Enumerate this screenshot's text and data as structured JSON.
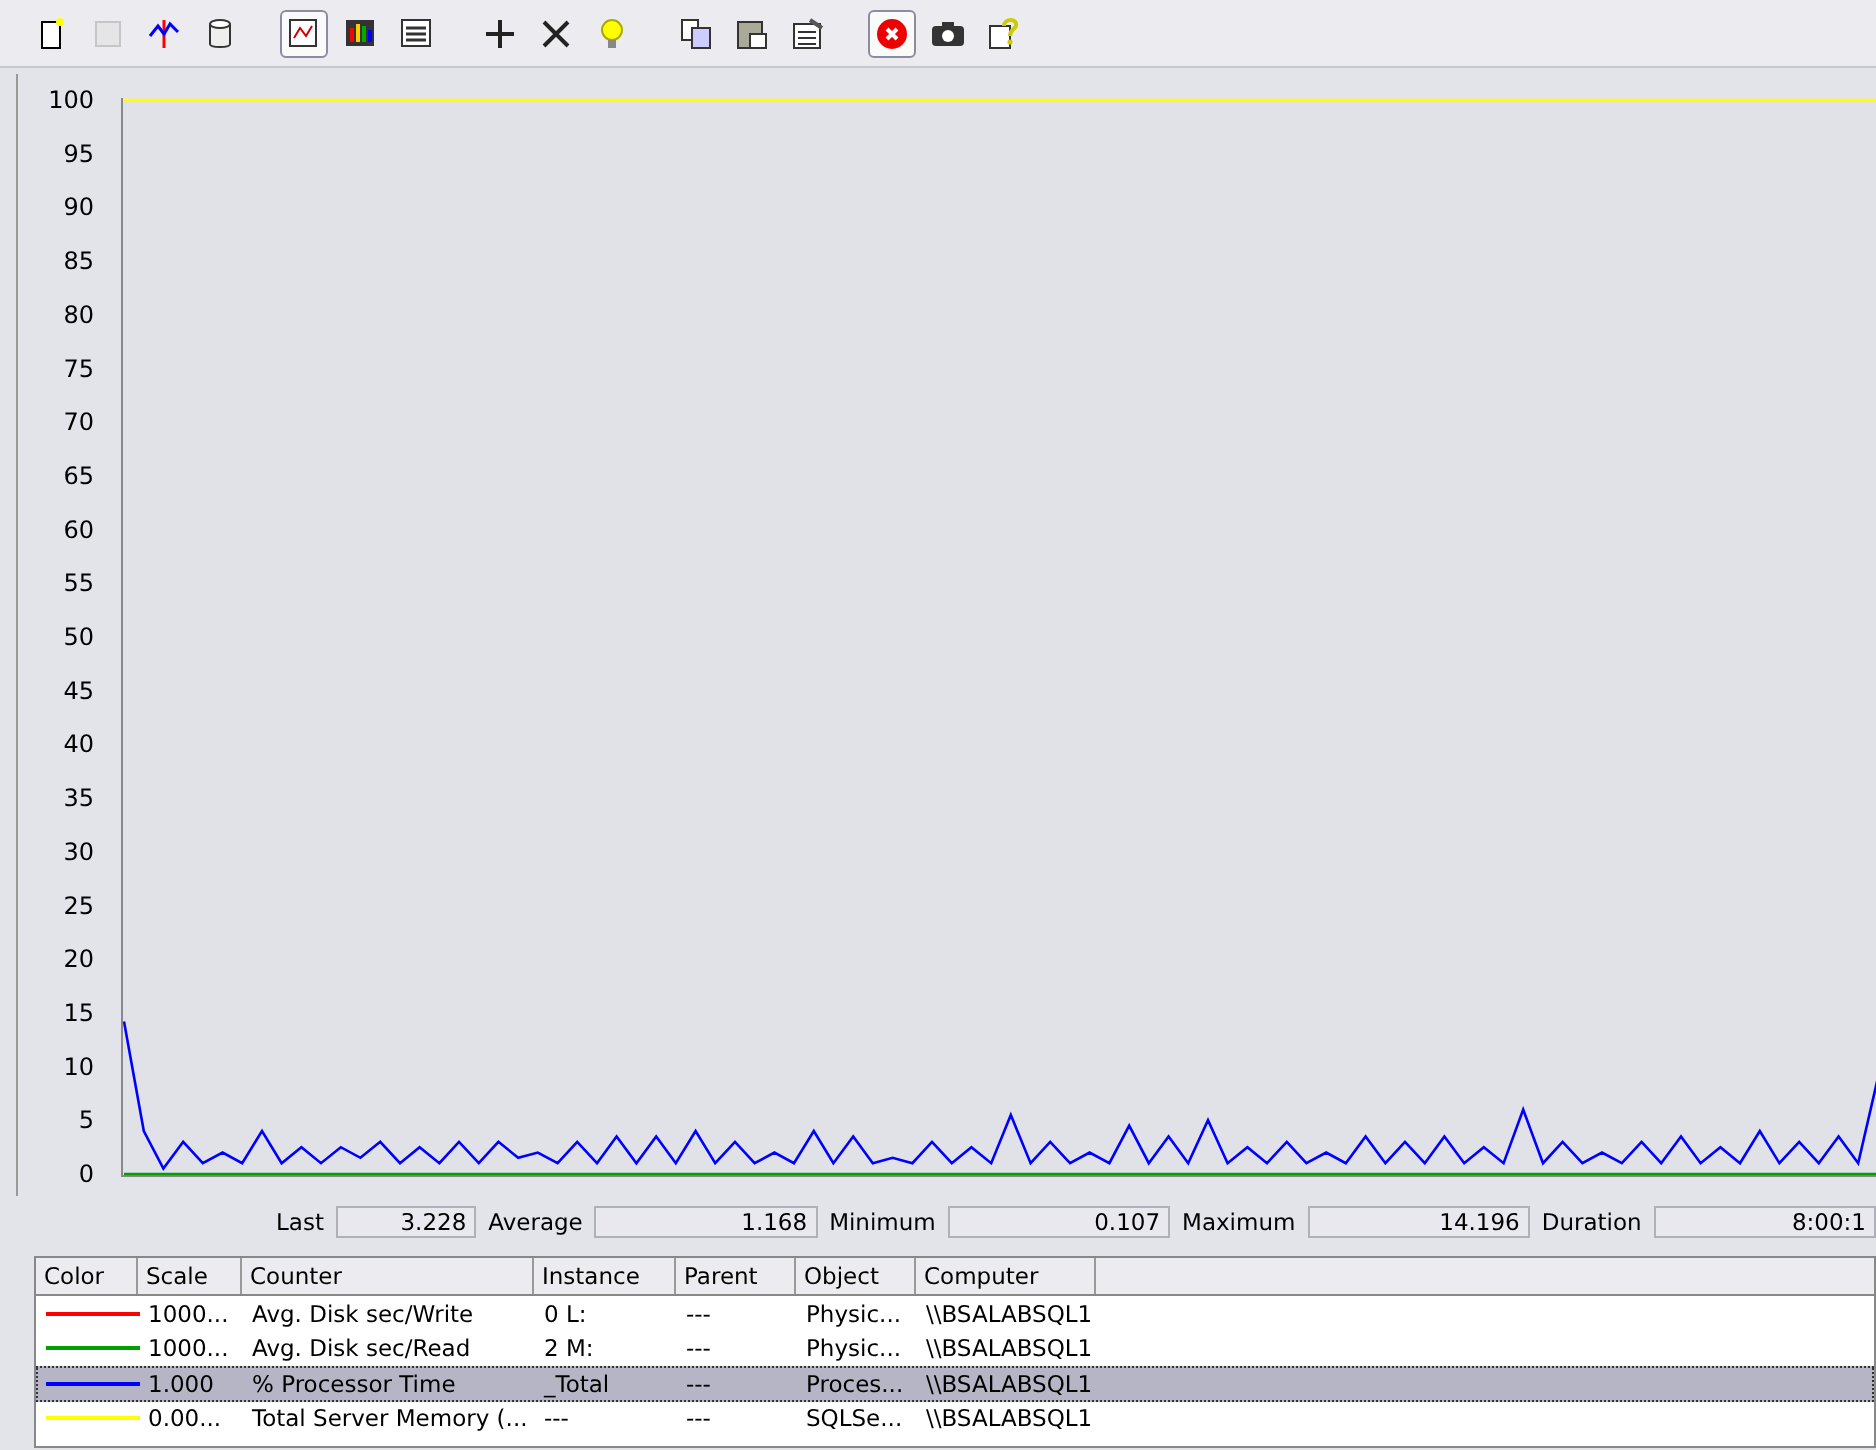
{
  "toolbar": [
    {
      "kind": "new",
      "selected": false,
      "disabled": false
    },
    {
      "kind": "clear",
      "selected": false,
      "disabled": true
    },
    {
      "kind": "spark",
      "selected": false,
      "disabled": false
    },
    {
      "kind": "database",
      "selected": false,
      "disabled": false
    },
    {
      "kind": "graph",
      "selected": true,
      "disabled": false
    },
    {
      "kind": "histogram",
      "selected": false,
      "disabled": false
    },
    {
      "kind": "report",
      "selected": false,
      "disabled": false
    },
    {
      "kind": "add",
      "selected": false,
      "disabled": false
    },
    {
      "kind": "delete",
      "selected": false,
      "disabled": false
    },
    {
      "kind": "bulb",
      "selected": false,
      "disabled": false
    },
    {
      "kind": "copy",
      "selected": false,
      "disabled": false
    },
    {
      "kind": "paste",
      "selected": false,
      "disabled": false
    },
    {
      "kind": "properties",
      "selected": false,
      "disabled": false
    },
    {
      "kind": "stop",
      "selected": true,
      "disabled": false
    },
    {
      "kind": "camera",
      "selected": false,
      "disabled": false
    },
    {
      "kind": "help",
      "selected": false,
      "disabled": false
    }
  ],
  "graph": {
    "chart_data": {
      "type": "line",
      "ylim": [
        0,
        100
      ],
      "yticks": [
        0,
        5,
        10,
        15,
        20,
        25,
        30,
        35,
        40,
        45,
        50,
        55,
        60,
        65,
        70,
        75,
        80,
        85,
        90,
        95,
        100
      ],
      "series": [
        {
          "color": "#00a000",
          "values": [
            0,
            0,
            0,
            0,
            0,
            0,
            0,
            0,
            0,
            0,
            0,
            0,
            0,
            0,
            0,
            0,
            0,
            0,
            0,
            0,
            0,
            0,
            0,
            0,
            0,
            0,
            0,
            0,
            0,
            0,
            0,
            0,
            0,
            0,
            0,
            0,
            0,
            0,
            0,
            0,
            0,
            0,
            0,
            0,
            0,
            0,
            0,
            0,
            0,
            0,
            0,
            0,
            0,
            0,
            0,
            0,
            0,
            0,
            0,
            0,
            0,
            0,
            0,
            0,
            0,
            0,
            0,
            0,
            0,
            0,
            0,
            0,
            0,
            0,
            0,
            0,
            0,
            0,
            0,
            0,
            0,
            0,
            0,
            0,
            0,
            0,
            0,
            0,
            0,
            0
          ]
        },
        {
          "color": "#0000ff",
          "values": [
            14.2,
            4,
            0.5,
            3,
            1,
            2,
            1,
            4,
            1,
            2.5,
            1,
            2.5,
            1.5,
            3,
            1,
            2.5,
            1,
            3,
            1,
            3,
            1.5,
            2,
            1,
            3,
            1,
            3.5,
            1,
            3.5,
            1,
            4,
            1,
            3,
            1,
            2,
            1,
            4,
            1,
            3.5,
            1,
            1.5,
            1,
            3,
            1,
            2.5,
            1,
            5.5,
            1,
            3,
            1,
            2,
            1,
            4.5,
            1,
            3.5,
            1,
            5,
            1,
            2.5,
            1,
            3,
            1,
            2,
            1,
            3.5,
            1,
            3,
            1,
            3.5,
            1,
            2.5,
            1,
            6,
            1,
            3,
            1,
            2,
            1,
            3,
            1,
            3.5,
            1,
            2.5,
            1,
            4,
            1,
            3,
            1,
            3.5,
            1,
            9
          ]
        },
        {
          "color": "#ffff00",
          "values": [
            100,
            100,
            100,
            100,
            100,
            100,
            100,
            100,
            100,
            100,
            100,
            100,
            100,
            100,
            100,
            100,
            100,
            100,
            100,
            100,
            100,
            100,
            100,
            100,
            100,
            100,
            100,
            100,
            100,
            100,
            100,
            100,
            100,
            100,
            100,
            100,
            100,
            100,
            100,
            100,
            100,
            100,
            100,
            100,
            100,
            100,
            100,
            100,
            100,
            100,
            100,
            100,
            100,
            100,
            100,
            100,
            100,
            100,
            100,
            100,
            100,
            100,
            100,
            100,
            100,
            100,
            100,
            100,
            100,
            100,
            100,
            100,
            100,
            100,
            100,
            100,
            100,
            100,
            100,
            100,
            100,
            100,
            100,
            100,
            100,
            100,
            100,
            100,
            100,
            100
          ]
        }
      ]
    }
  },
  "stats": [
    {
      "label": "Last",
      "value": "3.228"
    },
    {
      "label": "Average",
      "value": "1.168"
    },
    {
      "label": "Minimum",
      "value": "0.107"
    },
    {
      "label": "Maximum",
      "value": "14.196"
    },
    {
      "label": "Duration",
      "value": "8:00:1"
    }
  ],
  "legend": {
    "columns": [
      "Color",
      "Scale",
      "Counter",
      "Instance",
      "Parent",
      "Object",
      "Computer"
    ],
    "rows": [
      {
        "color": "#ff0000",
        "scale": "1000...",
        "counter": "Avg. Disk sec/Write",
        "instance": "0 L:",
        "parent": "---",
        "object": "Physic...",
        "computer": "\\\\BSALABSQL1",
        "selected": false
      },
      {
        "color": "#00a000",
        "scale": "1000...",
        "counter": "Avg. Disk sec/Read",
        "instance": "2 M:",
        "parent": "---",
        "object": "Physic...",
        "computer": "\\\\BSALABSQL1",
        "selected": false
      },
      {
        "color": "#0000ff",
        "scale": "1.000",
        "counter": "% Processor Time",
        "instance": "_Total",
        "parent": "---",
        "object": "Proces...",
        "computer": "\\\\BSALABSQL1",
        "selected": true
      },
      {
        "color": "#ffff00",
        "scale": "0.00...",
        "counter": "Total Server Memory (...",
        "instance": "---",
        "parent": "---",
        "object": "SQLSe...",
        "computer": "\\\\BSALABSQL1",
        "selected": false
      }
    ]
  }
}
